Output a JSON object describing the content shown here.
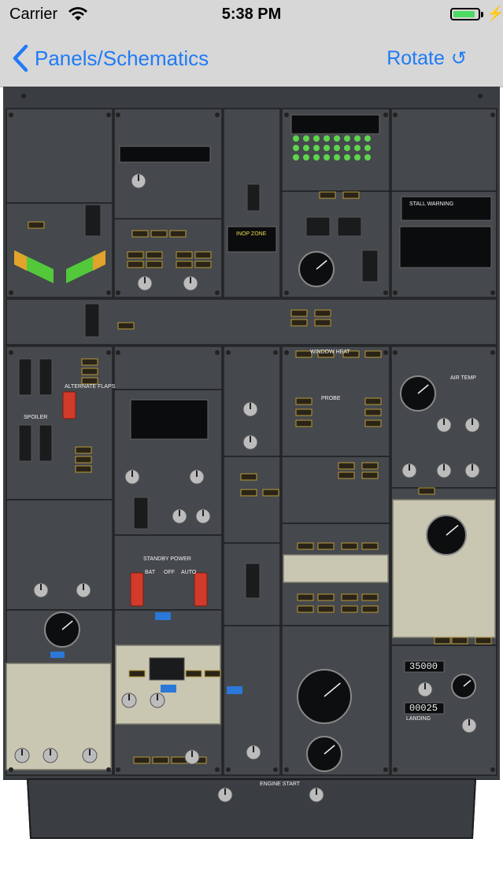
{
  "status_bar": {
    "carrier": "Carrier",
    "time": "5:38 PM",
    "battery_level": 0.9
  },
  "nav": {
    "back_label": "Panels/Schematics",
    "rotate_label": "Rotate",
    "rotate_icon": "↺",
    "accent_color": "#1f7bf6"
  },
  "panel": {
    "labels": {
      "stall_warning": "STALL WARNING",
      "inop_zone": "INOP ZONE",
      "alternate_flaps": "ALTERNATE FLAPS",
      "spoiler": "SPOILER",
      "standby_power": "STANDBY POWER",
      "probe": "PROBE",
      "window_heat": "WINDOW HEAT",
      "engine_start": "ENGINE START",
      "bat": "BAT",
      "off": "OFF",
      "auto": "AUTO",
      "altitude_readout": "35000",
      "rate_readout": "00025",
      "auto_cutoff": "AUTO",
      "landing": "LANDING",
      "air_temp": "AIR TEMP"
    }
  }
}
